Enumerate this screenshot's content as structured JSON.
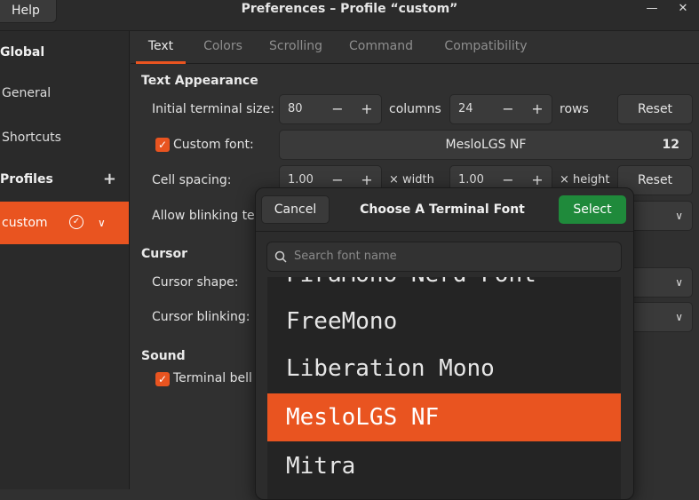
{
  "window": {
    "title": "Preferences – Profile “custom”",
    "help_label": "Help",
    "minimize_glyph": "—",
    "close_glyph": "✕"
  },
  "sidebar": {
    "global_heading": "Global",
    "items": [
      {
        "label": "General"
      },
      {
        "label": "Shortcuts"
      }
    ],
    "profiles_heading": "Profiles",
    "add_glyph": "+",
    "profiles": [
      {
        "label": "custom",
        "default": true
      }
    ]
  },
  "tabs": [
    {
      "label": "Text",
      "active": true
    },
    {
      "label": "Colors",
      "active": false
    },
    {
      "label": "Scrolling",
      "active": false
    },
    {
      "label": "Command",
      "active": false
    },
    {
      "label": "Compatibility",
      "active": false
    }
  ],
  "text_appearance": {
    "heading": "Text Appearance",
    "initial_size_label": "Initial terminal size:",
    "columns_value": "80",
    "columns_unit": "columns",
    "rows_value": "24",
    "rows_unit": "rows",
    "reset_label": "Reset",
    "custom_font_label": "Custom font:",
    "custom_font_checked": true,
    "font_name": "MesloLGS NF",
    "font_size": "12",
    "cell_spacing_label": "Cell spacing:",
    "width_value": "1.00",
    "width_unit": "× width",
    "height_value": "1.00",
    "height_unit": "× height",
    "reset2_label": "Reset",
    "blinking_label": "Allow blinking tex"
  },
  "cursor": {
    "heading": "Cursor",
    "shape_label": "Cursor shape:",
    "blinking_label": "Cursor blinking:"
  },
  "sound": {
    "heading": "Sound",
    "bell_label": "Terminal bell",
    "bell_checked": true
  },
  "stepper": {
    "minus": "−",
    "plus": "+"
  },
  "font_dialog": {
    "title": "Choose A Terminal Font",
    "cancel_label": "Cancel",
    "select_label": "Select",
    "search_placeholder": "Search font name",
    "fonts": [
      {
        "name": "FiraMono Nerd Font",
        "selected": false
      },
      {
        "name": "FreeMono",
        "selected": false
      },
      {
        "name": "Liberation Mono",
        "selected": false
      },
      {
        "name": "MesloLGS NF",
        "selected": true
      },
      {
        "name": "Mitra",
        "selected": false
      }
    ]
  },
  "colors": {
    "accent": "#e95420",
    "confirm": "#1f8a3b"
  }
}
